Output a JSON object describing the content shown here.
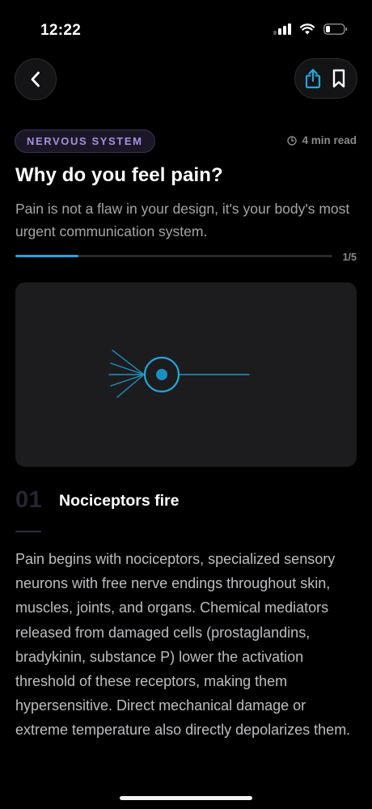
{
  "status_bar": {
    "time": "12:22"
  },
  "header": {
    "back_icon": "chevron-left-icon",
    "share_icon": "share-icon",
    "bookmark_icon": "bookmark-icon"
  },
  "article": {
    "category": "NERVOUS SYSTEM",
    "read_time": "4 min read",
    "title": "Why do you feel pain?",
    "subtitle": "Pain is not a flaw in your design, it's your body's most urgent communication system.",
    "progress": {
      "fraction": 0.2,
      "label": "1/5"
    }
  },
  "section": {
    "number": "01",
    "title": "Nociceptors fire",
    "body": "Pain begins with nociceptors, specialized sensory neurons with free nerve endings throughout skin, muscles, joints, and organs. Chemical mediators released from damaged cells (prostaglandins, bradykinin, substance P) lower the activation threshold of these receptors, making them hypersensitive. Direct mechanical damage or extreme temperature also directly depolarizes them."
  },
  "pager": {
    "count": 5,
    "active": 0
  },
  "colors": {
    "accent": "#22a8dd",
    "tag": "#a68ee0",
    "background": "#000000",
    "card": "#1c1c1e"
  }
}
